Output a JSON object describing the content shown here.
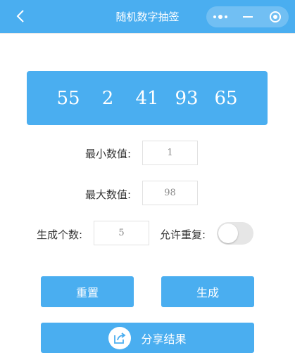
{
  "nav": {
    "title": "随机数字抽签"
  },
  "result": {
    "numbers": [
      "55",
      "2",
      "41",
      "93",
      "65"
    ]
  },
  "form": {
    "min_label": "最小数值:",
    "min_value": "1",
    "max_label": "最大数值:",
    "max_value": "98",
    "count_label": "生成个数:",
    "count_value": "5",
    "repeat_label": "允许重复:",
    "repeat_enabled": false
  },
  "buttons": {
    "reset_label": "重置",
    "generate_label": "生成",
    "share_label": "分享结果"
  },
  "colors": {
    "accent": "#4aaef0",
    "toggle_off": "#e6e6e6"
  }
}
